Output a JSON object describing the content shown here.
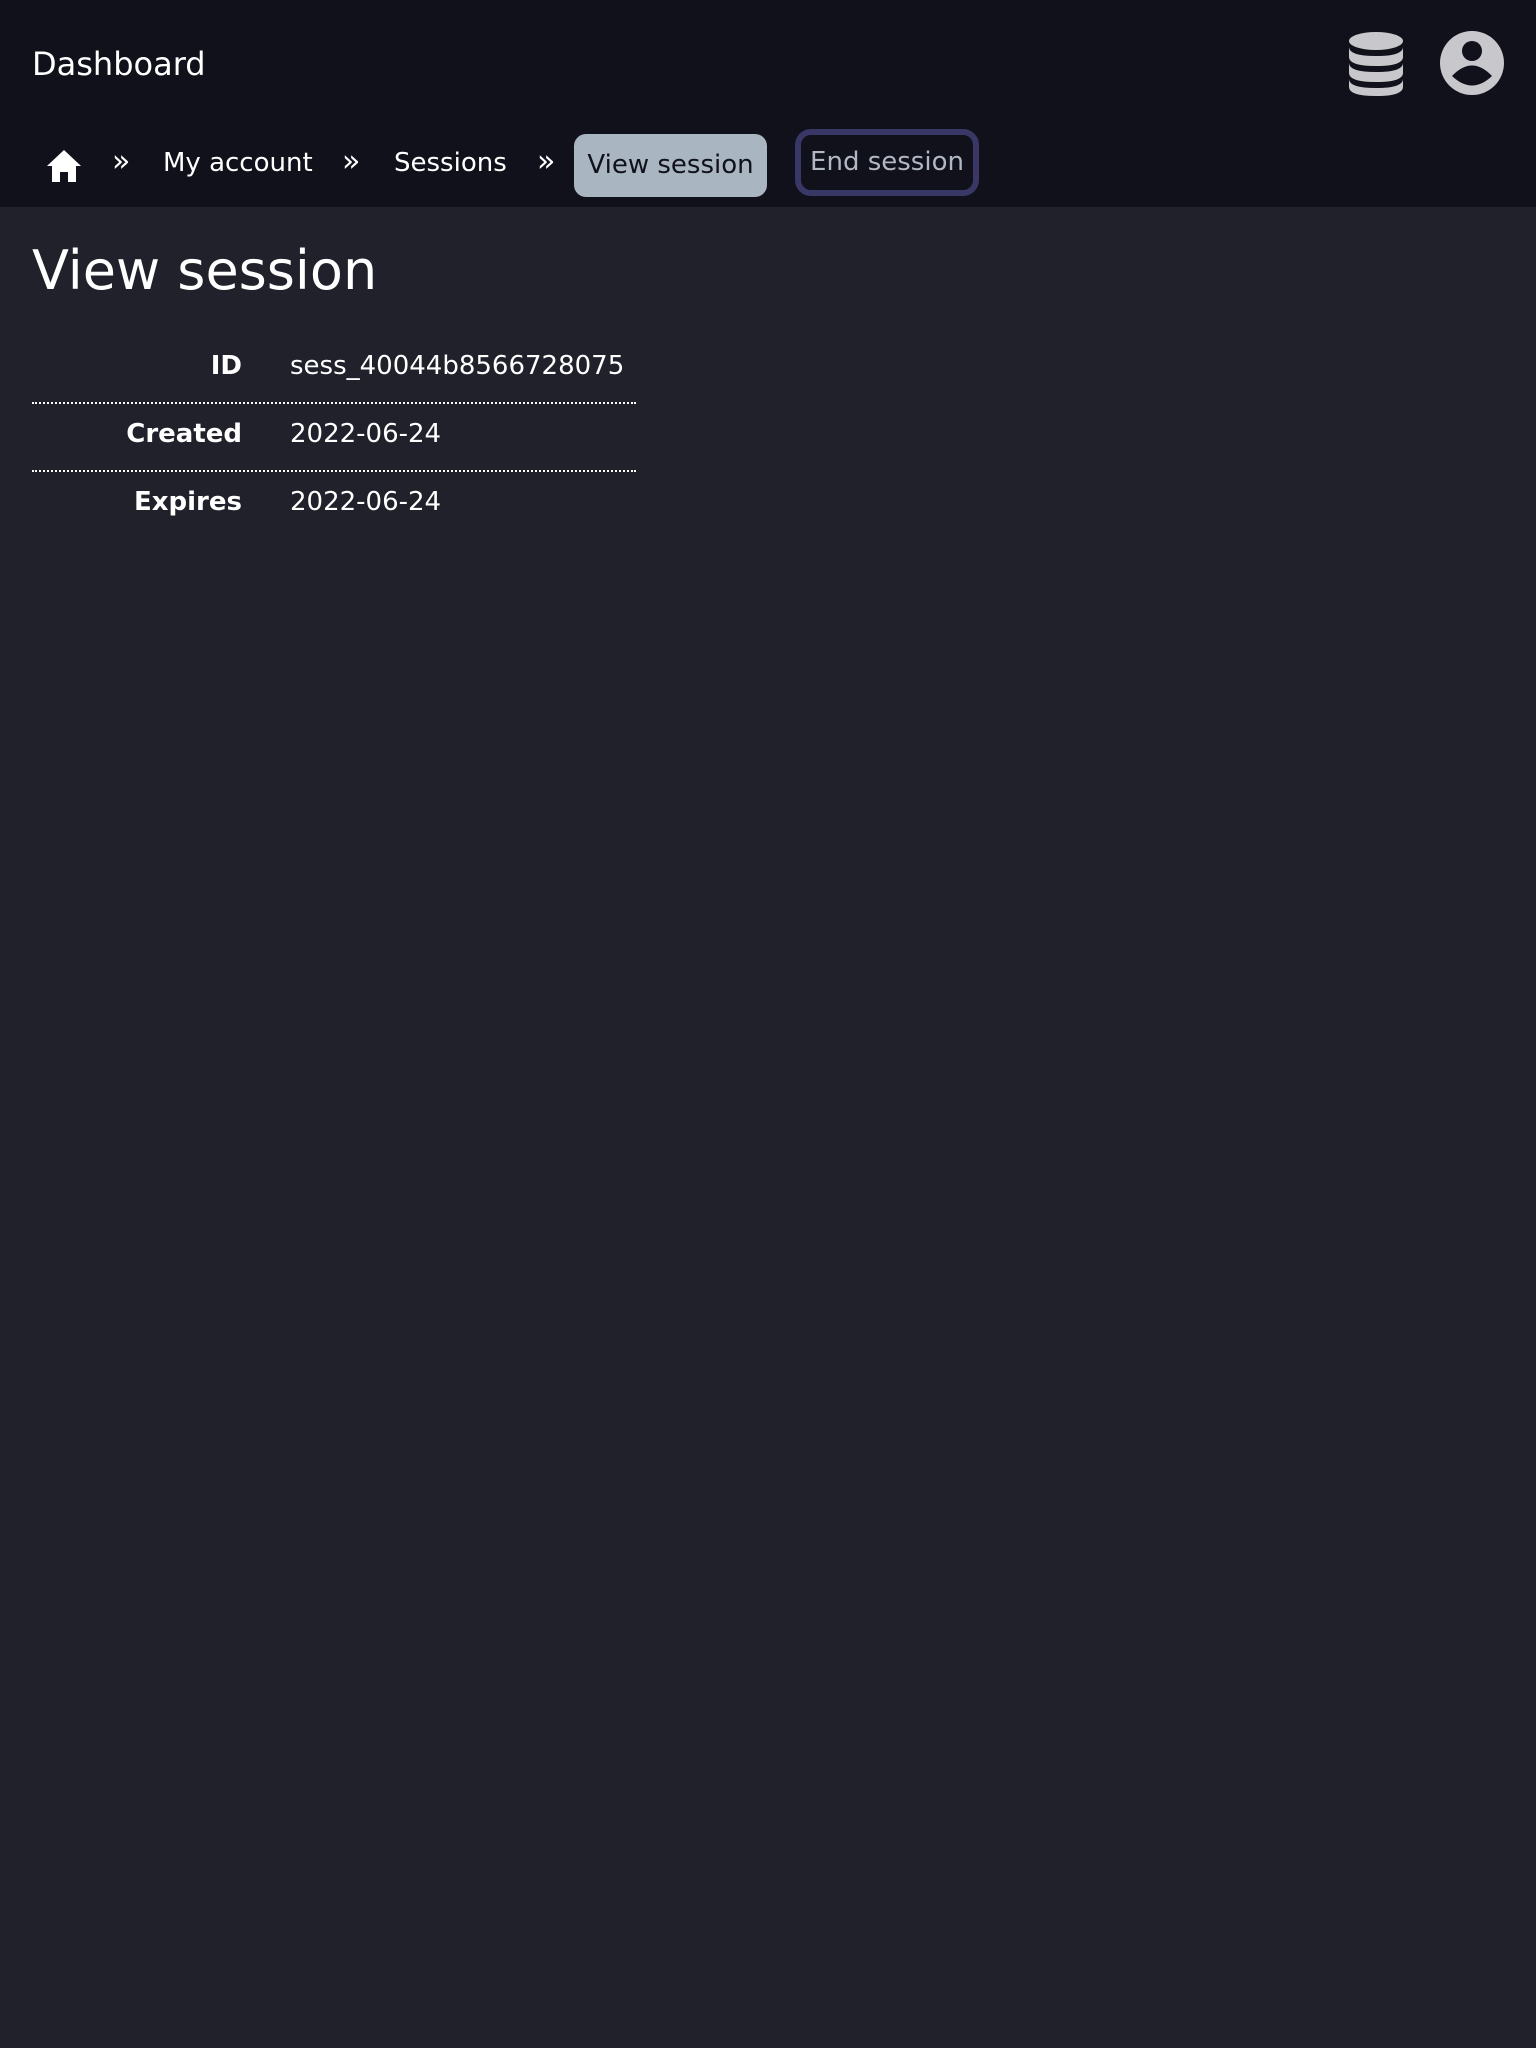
{
  "app": {
    "title": "Dashboard"
  },
  "header": {
    "icons": {
      "database": "database-icon",
      "account": "user-circle-icon"
    },
    "icon_color": "#c8c8cc"
  },
  "breadcrumb": {
    "home_icon": "home-icon",
    "separator": "»",
    "items": [
      {
        "label": "My account"
      },
      {
        "label": "Sessions"
      },
      {
        "label": "View session",
        "current": true
      }
    ]
  },
  "actions": {
    "end_session_label": "End session"
  },
  "page": {
    "title": "View session"
  },
  "session": {
    "fields": [
      {
        "label": "ID",
        "value": "sess_40044b8566728075"
      },
      {
        "label": "Created",
        "value": "2022-06-24"
      },
      {
        "label": "Expires",
        "value": "2022-06-24"
      }
    ]
  },
  "colors": {
    "background": "#20212b",
    "topbar": "#10111b",
    "current_crumb_bg": "#a9b5c1",
    "button_border": "#393766",
    "button_text": "#b2b7c4"
  }
}
